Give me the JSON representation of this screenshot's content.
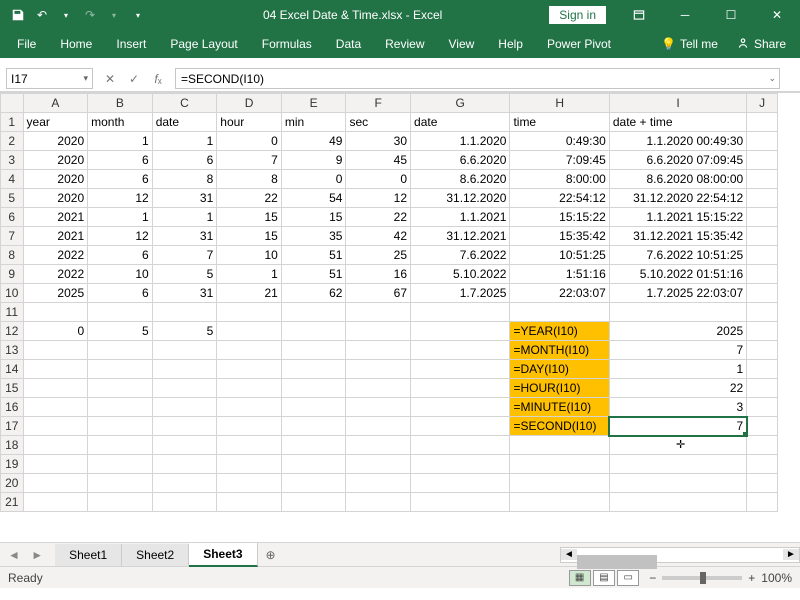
{
  "title": "04 Excel Date & Time.xlsx  -  Excel",
  "signin": "Sign in",
  "ribbon_tabs": [
    "File",
    "Home",
    "Insert",
    "Page Layout",
    "Formulas",
    "Data",
    "Review",
    "View",
    "Help",
    "Power Pivot"
  ],
  "tell_me": "Tell me",
  "share": "Share",
  "namebox": "I17",
  "formula": "=SECOND(I10)",
  "columns": [
    "A",
    "B",
    "C",
    "D",
    "E",
    "F",
    "G",
    "H",
    "I",
    "J"
  ],
  "rownums": [
    1,
    2,
    3,
    4,
    5,
    6,
    7,
    8,
    9,
    10,
    11,
    12,
    13,
    14,
    15,
    16,
    17,
    18,
    19,
    20,
    21
  ],
  "headers": {
    "A": "year",
    "B": "month",
    "C": "date",
    "D": "hour",
    "E": "min",
    "F": "sec",
    "G": "date",
    "H": "time",
    "I": "date + time"
  },
  "rows": [
    {
      "A": "2020",
      "B": "1",
      "C": "1",
      "D": "0",
      "E": "49",
      "F": "30",
      "G": "1.1.2020",
      "H": "0:49:30",
      "I": "1.1.2020 00:49:30"
    },
    {
      "A": "2020",
      "B": "6",
      "C": "6",
      "D": "7",
      "E": "9",
      "F": "45",
      "G": "6.6.2020",
      "H": "7:09:45",
      "I": "6.6.2020 07:09:45"
    },
    {
      "A": "2020",
      "B": "6",
      "C": "8",
      "D": "8",
      "E": "0",
      "F": "0",
      "G": "8.6.2020",
      "H": "8:00:00",
      "I": "8.6.2020 08:00:00"
    },
    {
      "A": "2020",
      "B": "12",
      "C": "31",
      "D": "22",
      "E": "54",
      "F": "12",
      "G": "31.12.2020",
      "H": "22:54:12",
      "I": "31.12.2020 22:54:12"
    },
    {
      "A": "2021",
      "B": "1",
      "C": "1",
      "D": "15",
      "E": "15",
      "F": "22",
      "G": "1.1.2021",
      "H": "15:15:22",
      "I": "1.1.2021 15:15:22"
    },
    {
      "A": "2021",
      "B": "12",
      "C": "31",
      "D": "15",
      "E": "35",
      "F": "42",
      "G": "31.12.2021",
      "H": "15:35:42",
      "I": "31.12.2021 15:35:42"
    },
    {
      "A": "2022",
      "B": "6",
      "C": "7",
      "D": "10",
      "E": "51",
      "F": "25",
      "G": "7.6.2022",
      "H": "10:51:25",
      "I": "7.6.2022 10:51:25"
    },
    {
      "A": "2022",
      "B": "10",
      "C": "5",
      "D": "1",
      "E": "51",
      "F": "16",
      "G": "5.10.2022",
      "H": "1:51:16",
      "I": "5.10.2022 01:51:16"
    },
    {
      "A": "2025",
      "B": "6",
      "C": "31",
      "D": "21",
      "E": "62",
      "F": "67",
      "G": "1.7.2025",
      "H": "22:03:07",
      "I": "1.7.2025 22:03:07"
    }
  ],
  "row12": {
    "A": "0",
    "B": "5",
    "C": "5"
  },
  "formulas": [
    {
      "label": "=YEAR(I10)",
      "val": "2025"
    },
    {
      "label": "=MONTH(I10)",
      "val": "7"
    },
    {
      "label": "=DAY(I10)",
      "val": "1"
    },
    {
      "label": "=HOUR(I10)",
      "val": "22"
    },
    {
      "label": "=MINUTE(I10)",
      "val": "3"
    },
    {
      "label": "=SECOND(I10)",
      "val": "7"
    }
  ],
  "sheets": [
    "Sheet1",
    "Sheet2",
    "Sheet3"
  ],
  "active_sheet": 2,
  "status": "Ready",
  "zoom": "100%"
}
